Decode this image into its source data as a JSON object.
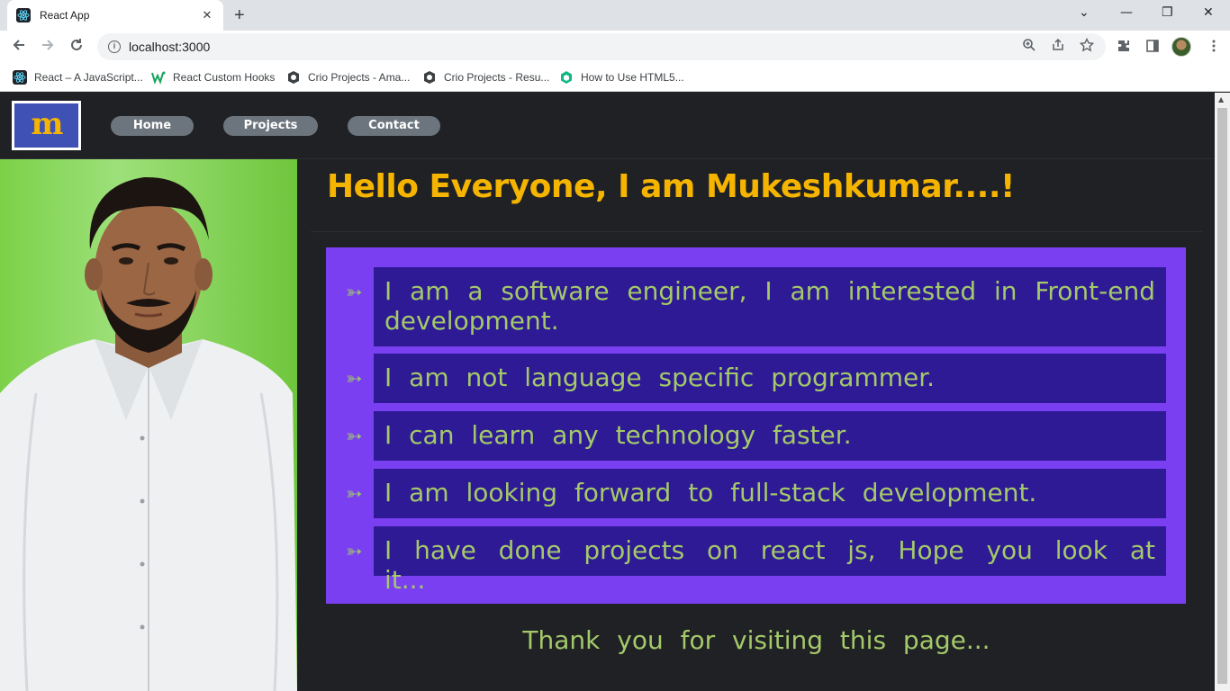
{
  "browser": {
    "tab_title": "React App",
    "tab_close": "✕",
    "new_tab": "+",
    "url": "localhost:3000",
    "window_controls": {
      "dropdown": "⌄",
      "minimize": "—",
      "restore": "❐",
      "close": "✕"
    },
    "bookmarks": [
      {
        "label": "React – A JavaScript...",
        "icon": "react-icon"
      },
      {
        "label": "React Custom Hooks",
        "icon": "w-logo-icon"
      },
      {
        "label": "Crio Projects - Ama...",
        "icon": "crio-icon"
      },
      {
        "label": "Crio Projects - Resu...",
        "icon": "crio-icon"
      },
      {
        "label": "How to Use HTML5...",
        "icon": "cube-icon"
      }
    ]
  },
  "site": {
    "logo_text": "m",
    "nav": {
      "home": "Home",
      "projects": "Projects",
      "contact": "Contact"
    },
    "headline": "Hello Everyone, I am Mukeshkumar....!",
    "bullet_glyph": "➳",
    "points": [
      "I am a software engineer, I am interested in Front-end development.",
      "I am not language specific programmer.",
      "I can learn any technology faster.",
      "I am looking forward to full-stack development.",
      "I have done projects on react js, Hope you look at it..."
    ],
    "thanks": "Thank you for visiting this page..."
  },
  "colors": {
    "accent_yellow": "#f5b400",
    "point_text": "#a4c96a",
    "points_bg": "#7b3ff2",
    "card_bg": "#2e1a94",
    "page_bg": "#202124"
  }
}
